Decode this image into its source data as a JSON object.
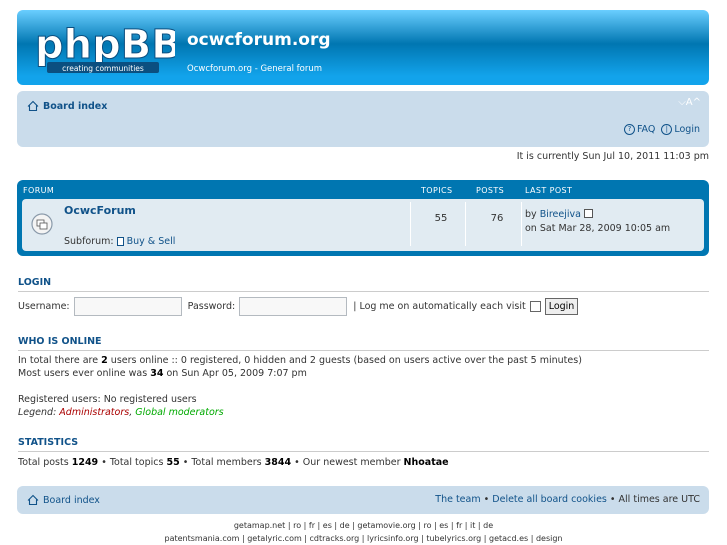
{
  "header": {
    "logo_text": "phpBB",
    "logo_tagline": "creating communities",
    "site_title": "ocwcforum.org",
    "site_description": "Ocwcforum.org - General forum"
  },
  "navbar": {
    "board_index": "Board index",
    "font_resize": "⌵A^",
    "faq": "FAQ",
    "login": "Login"
  },
  "current_time": "It is currently Sun Jul 10, 2011 11:03 pm",
  "forum_table": {
    "headers": {
      "forum": "FORUM",
      "topics": "TOPICS",
      "posts": "POSTS",
      "last_post": "LAST POST"
    },
    "forum": {
      "name": "OcwcForum",
      "subforum_label": "Subforum:",
      "subforum_link": "Buy & Sell",
      "topics": "55",
      "posts": "76",
      "last_post_by_label": "by",
      "last_post_author": "Bireejiva",
      "last_post_date": "on Sat Mar 28, 2009 10:05 am"
    }
  },
  "login": {
    "title": "LOGIN",
    "username_label": "Username:",
    "password_label": "Password:",
    "autologin_label": "| Log me on automatically each visit",
    "button": "Login"
  },
  "who_is_online": {
    "title": "WHO IS ONLINE",
    "total_prefix": "In total there are",
    "total_count": "2",
    "total_suffix": "users online :: 0 registered, 0 hidden and 2 guests (based on users active over the past 5 minutes)",
    "max_prefix": "Most users ever online was",
    "max_count": "34",
    "max_suffix": "on Sun Apr 05, 2009 7:07 pm",
    "registered": "Registered users: No registered users",
    "legend_label": "Legend:",
    "legend_admins": "Administrators",
    "legend_sep": ",",
    "legend_gmods": "Global moderators"
  },
  "statistics": {
    "title": "STATISTICS",
    "posts_label": "Total posts",
    "posts": "1249",
    "topics_label": "• Total topics",
    "topics": "55",
    "members_label": "• Total members",
    "members": "3844",
    "newest_label": "• Our newest member",
    "newest": "Nhoatae"
  },
  "footer_nav": {
    "board_index": "Board index",
    "team": "The team",
    "sep1": "•",
    "delete_cookies": "Delete all board cookies",
    "sep2": "•",
    "timezone": "All times are UTC"
  },
  "credits": {
    "line1": "getamap.net | ro | fr | es | de | getamovie.org | ro | es | fr | it | de",
    "line2": "patentsmania.com | getalyric.com | cdtracks.org | lyricsinfo.org | tubelyrics.org | getacd.es | design"
  },
  "colors": {
    "header_blue": "#0076b1",
    "navbar_bg": "#cadceb",
    "row_bg": "#e1ebf2",
    "link": "#105289",
    "admin": "#aa0000",
    "gmod": "#00aa00"
  }
}
